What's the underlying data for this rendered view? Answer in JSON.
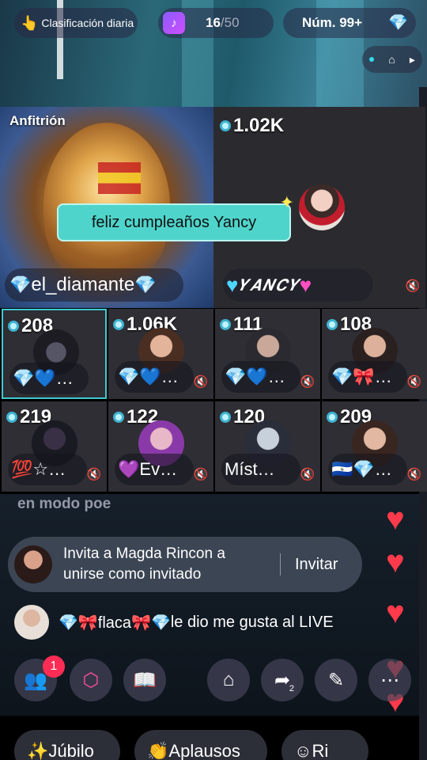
{
  "top_bar": {
    "daily_ranking": "Clasificación diaria",
    "gift_progress_current": "16",
    "gift_progress_total": "/50",
    "rank": "Núm. 99+"
  },
  "host": {
    "label": "Anfitrión",
    "name": "el_diamante",
    "prefix": "💎",
    "suffix": "💎"
  },
  "caption": "feliz cumpleaños Yancy",
  "main_guest": {
    "score": "1.02K",
    "name": "𝒀𝑨𝑵𝑪𝒀"
  },
  "guests": [
    {
      "score": "208",
      "name": "💎💙…",
      "muted": false
    },
    {
      "score": "1.06K",
      "name": "💎💙…",
      "muted": true
    },
    {
      "score": "111",
      "name": "💎💙…",
      "muted": true
    },
    {
      "score": "108",
      "name": "💎🎀…",
      "muted": true
    },
    {
      "score": "219",
      "name": "💯☆…",
      "muted": true
    },
    {
      "score": "122",
      "name": "💜Ev…",
      "muted": true
    },
    {
      "score": "120",
      "name": "Míst…",
      "muted": true
    },
    {
      "score": "209",
      "name": "🇸🇻💎…",
      "muted": true
    }
  ],
  "chat": {
    "partial_message": "en modo poe",
    "invite_text": "Invita a Magda Rincon a unirse como invitado",
    "invite_button": "Invitar",
    "like_user": "💎🎀flaca🎀💎",
    "like_text": " le dio me gusta al LIVE"
  },
  "action_bar": {
    "notification_count": "1",
    "share_count": "2"
  },
  "reactions": [
    "Júbilo",
    "Aplausos",
    "Ri"
  ],
  "colors": {
    "accent_teal": "#3ec9d0",
    "caption_bg": "#4fd4cb",
    "heart_red": "#ff3a4a",
    "badge_red": "#ff2d55"
  }
}
